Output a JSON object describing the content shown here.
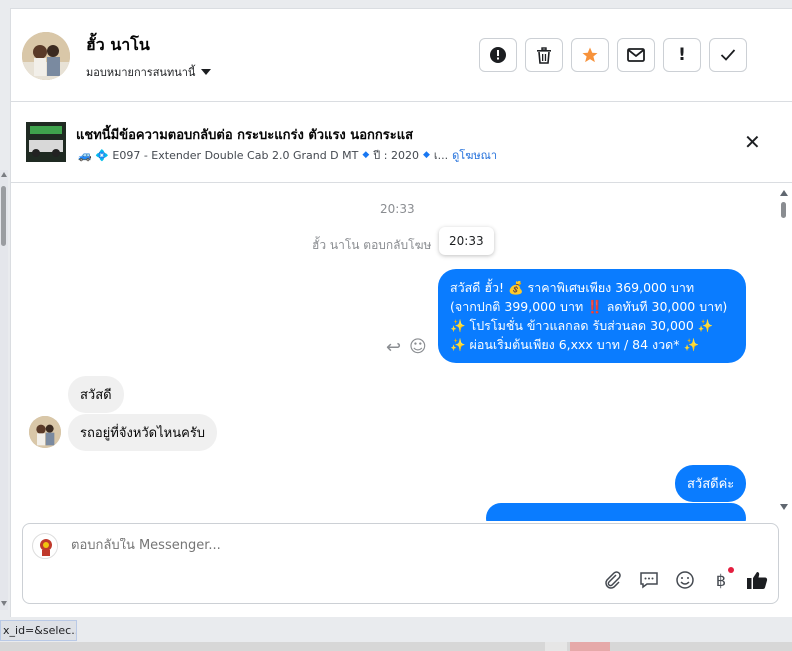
{
  "header": {
    "contact_name": "ฮั้ว นาโน",
    "assign_label": "มอบหมายการสนทนานี้",
    "actions": [
      {
        "name": "alert-circle-icon",
        "glyph": "⬤"
      },
      {
        "name": "trash-icon",
        "glyph": "🗑"
      },
      {
        "name": "star-icon",
        "glyph": "★"
      },
      {
        "name": "mail-icon",
        "glyph": "✉"
      },
      {
        "name": "exclamation-icon",
        "glyph": "!"
      },
      {
        "name": "check-icon",
        "glyph": "✓"
      }
    ]
  },
  "ad": {
    "title": "แชทนี้มีข้อความตอบกลับต่อ กระบะแกร่ง ตัวแรง นอกกระแส",
    "detail": "🚙 💠 E097 - Extender Double Cab 2.0 Grand D MT",
    "year": "ปี : 2020",
    "ellipsis": "เ...",
    "link": "ดูโฆษณา"
  },
  "chat": {
    "timestamp": "20:33",
    "system_text": "ฮั้ว นาโน ตอบกลับโฆษ",
    "tooltip": "20:33",
    "outgoing_lines": [
      "สวัสดี ฮั้ว! 💰 ราคาพิเศษเพียง 369,000 บาท",
      "(จากปกติ 399,000 บาท ‼️ ลดทันที 30,000 บาท)",
      "✨ โปรโมชั่น ข้าวแลกลด รับส่วนลด 30,000 ✨",
      "✨ ผ่อนเริ่มต้นเพียง 6,xxx บาท / 84 งวด* ✨"
    ],
    "incoming_1": "สวัสดี",
    "incoming_2": "รถอยู่ที่จังหวัดไหนครับ",
    "outgoing_2": "สวัสดีค่ะ"
  },
  "composer": {
    "placeholder": "ตอบกลับใน Messenger...",
    "icons": [
      "attach-icon",
      "saved-reply-icon",
      "emoji-icon",
      "baht-icon",
      "like-icon"
    ]
  },
  "statusbar": {
    "text": "x_id=&selec..."
  },
  "colors": {
    "accent": "#0a7cff",
    "star": "#f7923b",
    "link": "#216fdb"
  }
}
